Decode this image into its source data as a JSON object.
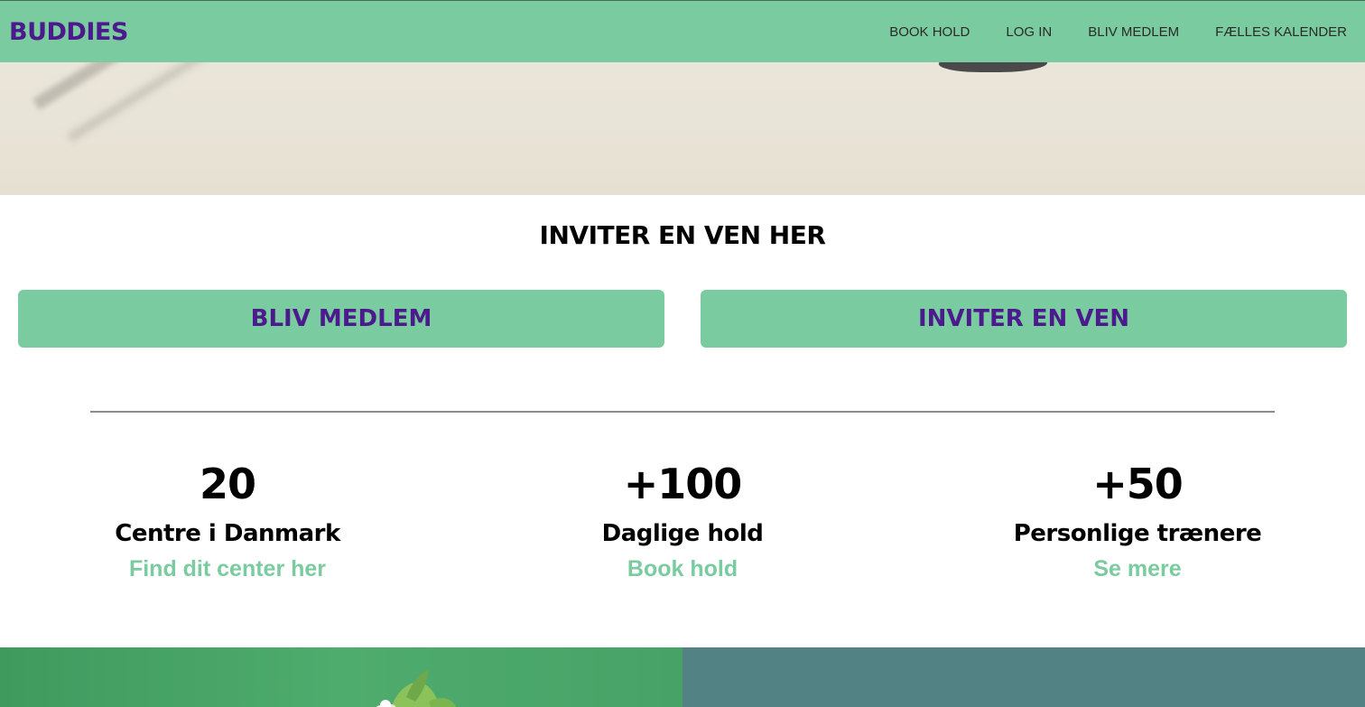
{
  "navbar": {
    "logo": "BUDDIES",
    "links": [
      "BOOK HOLD",
      "LOG IN",
      "BLIV MEDLEM",
      "FÆLLES KALENDER"
    ]
  },
  "invite_section": {
    "title": "INVITER EN VEN HER",
    "join_button": "BLIV MEDLEM",
    "invite_button": "INVITER EN VEN"
  },
  "stats": [
    {
      "number": "20",
      "label": "Centre i Danmark",
      "link": "Find dit center her"
    },
    {
      "number": "+100",
      "label": "Daglige hold",
      "link": "Book hold"
    },
    {
      "number": "+50",
      "label": "Personlige trænere",
      "link": "Se mere"
    }
  ],
  "colors": {
    "accent_green": "#7bcba0",
    "brand_purple": "#4b1a8c",
    "teal_panel": "#528284"
  }
}
